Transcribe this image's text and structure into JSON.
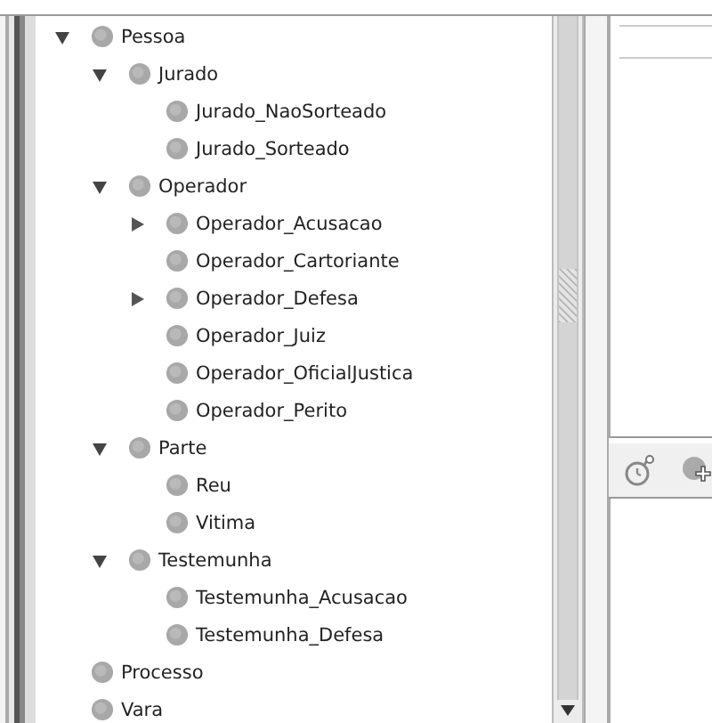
{
  "tree": [
    {
      "label": "Pessoa",
      "expanded": true,
      "children": [
        {
          "label": "Jurado",
          "expanded": true,
          "children": [
            {
              "label": "Jurado_NaoSorteado"
            },
            {
              "label": "Jurado_Sorteado"
            }
          ]
        },
        {
          "label": "Operador",
          "expanded": true,
          "children": [
            {
              "label": "Operador_Acusacao",
              "expanded": false
            },
            {
              "label": "Operador_Cartoriante"
            },
            {
              "label": "Operador_Defesa",
              "expanded": false
            },
            {
              "label": "Operador_Juiz"
            },
            {
              "label": "Operador_OficialJustica"
            },
            {
              "label": "Operador_Perito"
            }
          ]
        },
        {
          "label": "Parte",
          "expanded": true,
          "children": [
            {
              "label": "Reu"
            },
            {
              "label": "Vitima"
            }
          ]
        },
        {
          "label": "Testemunha",
          "expanded": true,
          "children": [
            {
              "label": "Testemunha_Acusacao"
            },
            {
              "label": "Testemunha_Defesa"
            }
          ]
        }
      ]
    },
    {
      "label": "Processo"
    },
    {
      "label": "Vara"
    }
  ]
}
